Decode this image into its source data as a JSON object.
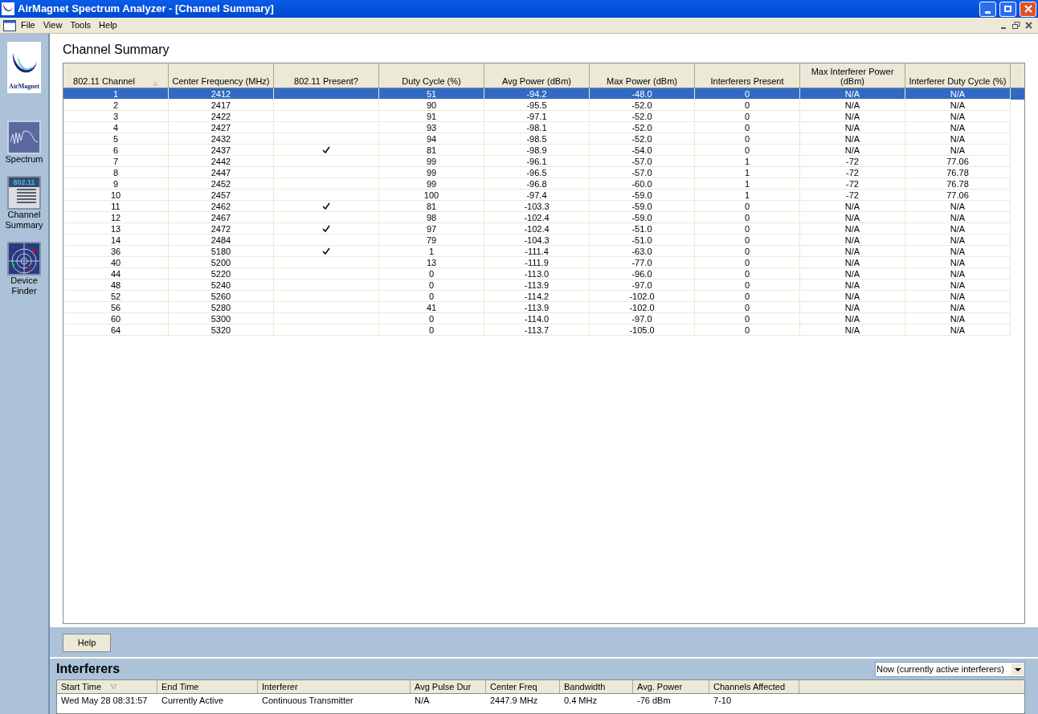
{
  "window": {
    "title": "AirMagnet Spectrum Analyzer - [Channel Summary]"
  },
  "menu": [
    "File",
    "View",
    "Tools",
    "Help"
  ],
  "sidebar": {
    "items": [
      {
        "kind": "logo",
        "logo_text": "AirMagnet"
      },
      {
        "label": "Spectrum",
        "kind": "spectrum"
      },
      {
        "label": "Channel Summary",
        "kind": "channels",
        "icon_text": "802.11"
      },
      {
        "label": "Device Finder",
        "kind": "finder"
      }
    ]
  },
  "channel_summary": {
    "title": "Channel Summary",
    "columns": [
      "802.11 Channel",
      "Center Frequency (MHz)",
      "802.11 Present?",
      "Duty Cycle (%)",
      "Avg Power (dBm)",
      "Max Power (dBm)",
      "Interferers Present",
      "Max Interferer Power (dBm)",
      "Interferer Duty Cycle (%)"
    ],
    "rows": [
      {
        "selected": true,
        "present": false,
        "cells": [
          "1",
          "2412",
          "",
          "51",
          "-94.2",
          "-48.0",
          "0",
          "N/A",
          "N/A"
        ]
      },
      {
        "selected": false,
        "present": false,
        "cells": [
          "2",
          "2417",
          "",
          "90",
          "-95.5",
          "-52.0",
          "0",
          "N/A",
          "N/A"
        ]
      },
      {
        "selected": false,
        "present": false,
        "cells": [
          "3",
          "2422",
          "",
          "91",
          "-97.1",
          "-52.0",
          "0",
          "N/A",
          "N/A"
        ]
      },
      {
        "selected": false,
        "present": false,
        "cells": [
          "4",
          "2427",
          "",
          "93",
          "-98.1",
          "-52.0",
          "0",
          "N/A",
          "N/A"
        ]
      },
      {
        "selected": false,
        "present": false,
        "cells": [
          "5",
          "2432",
          "",
          "94",
          "-98.5",
          "-52.0",
          "0",
          "N/A",
          "N/A"
        ]
      },
      {
        "selected": false,
        "present": true,
        "cells": [
          "6",
          "2437",
          "",
          "81",
          "-98.9",
          "-54.0",
          "0",
          "N/A",
          "N/A"
        ]
      },
      {
        "selected": false,
        "present": false,
        "cells": [
          "7",
          "2442",
          "",
          "99",
          "-96.1",
          "-57.0",
          "1",
          "-72",
          "77.06"
        ]
      },
      {
        "selected": false,
        "present": false,
        "cells": [
          "8",
          "2447",
          "",
          "99",
          "-96.5",
          "-57.0",
          "1",
          "-72",
          "76.78"
        ]
      },
      {
        "selected": false,
        "present": false,
        "cells": [
          "9",
          "2452",
          "",
          "99",
          "-96.8",
          "-60.0",
          "1",
          "-72",
          "76.78"
        ]
      },
      {
        "selected": false,
        "present": false,
        "cells": [
          "10",
          "2457",
          "",
          "100",
          "-97.4",
          "-59.0",
          "1",
          "-72",
          "77.06"
        ]
      },
      {
        "selected": false,
        "present": true,
        "cells": [
          "11",
          "2462",
          "",
          "81",
          "-103.3",
          "-59.0",
          "0",
          "N/A",
          "N/A"
        ]
      },
      {
        "selected": false,
        "present": false,
        "cells": [
          "12",
          "2467",
          "",
          "98",
          "-102.4",
          "-59.0",
          "0",
          "N/A",
          "N/A"
        ]
      },
      {
        "selected": false,
        "present": true,
        "cells": [
          "13",
          "2472",
          "",
          "97",
          "-102.4",
          "-51.0",
          "0",
          "N/A",
          "N/A"
        ]
      },
      {
        "selected": false,
        "present": false,
        "cells": [
          "14",
          "2484",
          "",
          "79",
          "-104.3",
          "-51.0",
          "0",
          "N/A",
          "N/A"
        ]
      },
      {
        "selected": false,
        "present": true,
        "cells": [
          "36",
          "5180",
          "",
          "1",
          "-111.4",
          "-63.0",
          "0",
          "N/A",
          "N/A"
        ]
      },
      {
        "selected": false,
        "present": false,
        "cells": [
          "40",
          "5200",
          "",
          "13",
          "-111.9",
          "-77.0",
          "0",
          "N/A",
          "N/A"
        ]
      },
      {
        "selected": false,
        "present": false,
        "cells": [
          "44",
          "5220",
          "",
          "0",
          "-113.0",
          "-96.0",
          "0",
          "N/A",
          "N/A"
        ]
      },
      {
        "selected": false,
        "present": false,
        "cells": [
          "48",
          "5240",
          "",
          "0",
          "-113.9",
          "-97.0",
          "0",
          "N/A",
          "N/A"
        ]
      },
      {
        "selected": false,
        "present": false,
        "cells": [
          "52",
          "5260",
          "",
          "0",
          "-114.2",
          "-102.0",
          "0",
          "N/A",
          "N/A"
        ]
      },
      {
        "selected": false,
        "present": false,
        "cells": [
          "56",
          "5280",
          "",
          "41",
          "-113.9",
          "-102.0",
          "0",
          "N/A",
          "N/A"
        ]
      },
      {
        "selected": false,
        "present": false,
        "cells": [
          "60",
          "5300",
          "",
          "0",
          "-114.0",
          "-97.0",
          "0",
          "N/A",
          "N/A"
        ]
      },
      {
        "selected": false,
        "present": false,
        "cells": [
          "64",
          "5320",
          "",
          "0",
          "-113.7",
          "-105.0",
          "0",
          "N/A",
          "N/A"
        ]
      }
    ],
    "help_button": "Help"
  },
  "interferers": {
    "title": "Interferers",
    "filter": "Now (currently active interferers)",
    "columns": [
      "Start Time",
      "End Time",
      "Interferer",
      "Avg Pulse Dur",
      "Center Freq",
      "Bandwidth",
      "Avg. Power",
      "Channels Affected"
    ],
    "rows": [
      [
        "Wed May 28 08:31:57",
        "Currently Active",
        "Continuous Transmitter",
        "N/A",
        "2447.9 MHz",
        "0.4 MHz",
        "-76 dBm",
        "7-10"
      ]
    ]
  }
}
